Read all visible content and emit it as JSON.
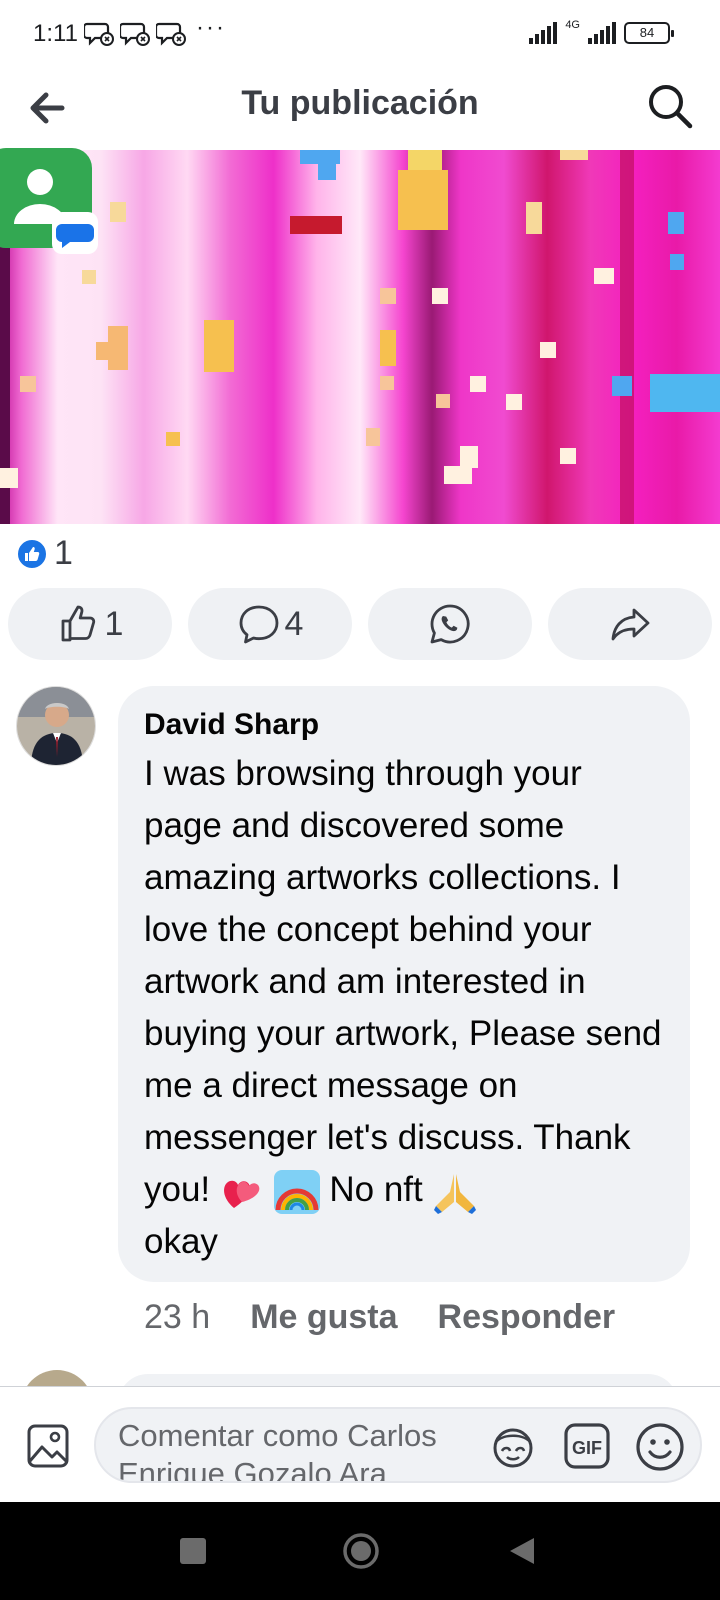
{
  "status_bar": {
    "time": "1:11",
    "dots": "···",
    "network": "4G",
    "battery": "84",
    "notification_icons": [
      "message-notif-icon",
      "message-notif-icon",
      "message-notif-icon"
    ]
  },
  "header": {
    "title": "Tu publicación",
    "back_icon": "arrow-left-icon",
    "search_icon": "search-icon"
  },
  "post": {
    "image_icon": "pixel-art-image",
    "overlay_app_icon": "messages-app-icon",
    "reaction_count": "1"
  },
  "actions": {
    "like_count": "1",
    "comment_count": "4",
    "whatsapp_icon": "whatsapp-icon",
    "share_icon": "share-icon"
  },
  "comment": {
    "author": "David Sharp",
    "text_main": "I was browsing through your page and discovered some amazing artworks collections. I love the concept behind your artwork and am interested in buying your artwork, Please send me a direct message on messenger let's discuss. Thank you!",
    "text_mid": "No nft",
    "text_end": "okay",
    "emojis": [
      "heart-emoji",
      "rainbow-emoji",
      "pray-emoji"
    ],
    "time": "23 h",
    "like_label": "Me gusta",
    "reply_label": "Responder"
  },
  "composer": {
    "placeholder": "Comentar como Carlos Enrique Gozalo Ara",
    "gif_label": "GIF"
  },
  "colors": {
    "facebook_blue": "#1b74e4",
    "bubble_bg": "#f0f2f5",
    "secondary_text": "#65676b"
  }
}
